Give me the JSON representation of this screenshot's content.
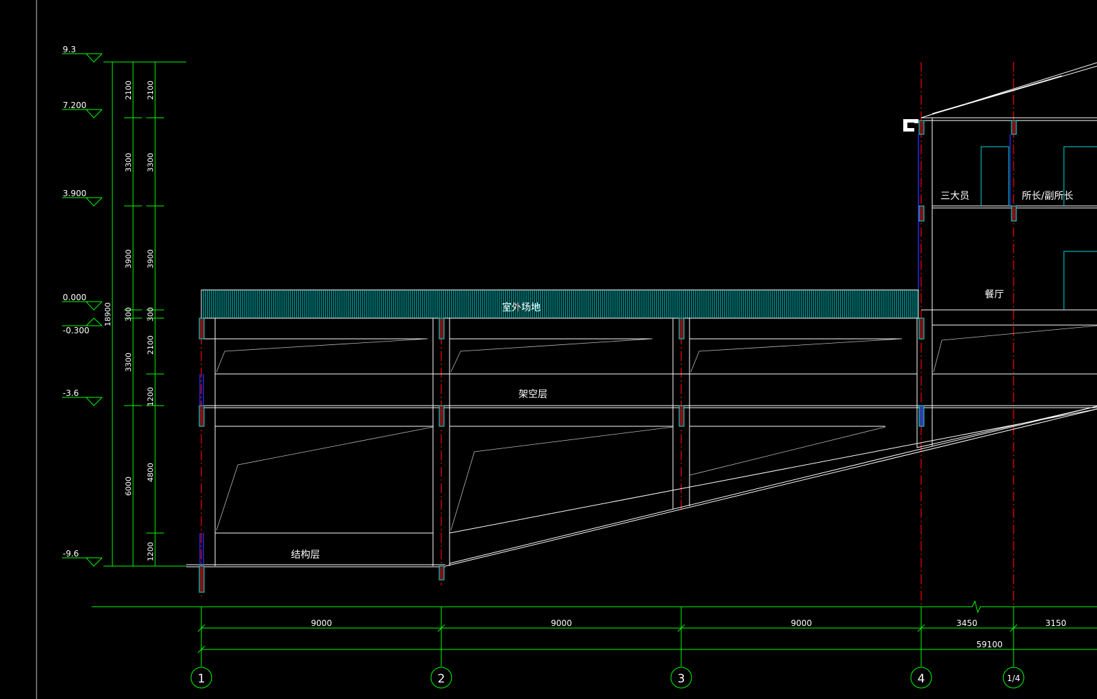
{
  "colors": {
    "background": "#000000",
    "green": "#00ff00",
    "white": "#ffffff",
    "red": "#ff0000",
    "cyan": "#00ffff",
    "blue": "#0000ff",
    "gray": "#c8c8c8"
  },
  "elevations": [
    "9.3",
    "7.200",
    "3.900",
    "0.000",
    "-0.300",
    "-3.6",
    "-9.6"
  ],
  "dims_left_outer": [
    "2100",
    "3300",
    "3900",
    "300",
    "3300",
    "6000"
  ],
  "dims_left_inner": [
    "2100",
    "3300",
    "3900",
    "300",
    "2100",
    "1200",
    "4800",
    "1200"
  ],
  "dim_total_height": "18900",
  "bay_dims": [
    "9000",
    "9000",
    "9000",
    "3450",
    "3150"
  ],
  "overall_dim": "59100",
  "axes": [
    "1",
    "2",
    "3",
    "4",
    "1/4"
  ],
  "rooms": {
    "outdoor": "室外场地",
    "stilt_floor": "架空层",
    "structure_floor": "结构层",
    "three_officers": "三大员",
    "director": "所长/副所长",
    "dining": "餐厅"
  }
}
